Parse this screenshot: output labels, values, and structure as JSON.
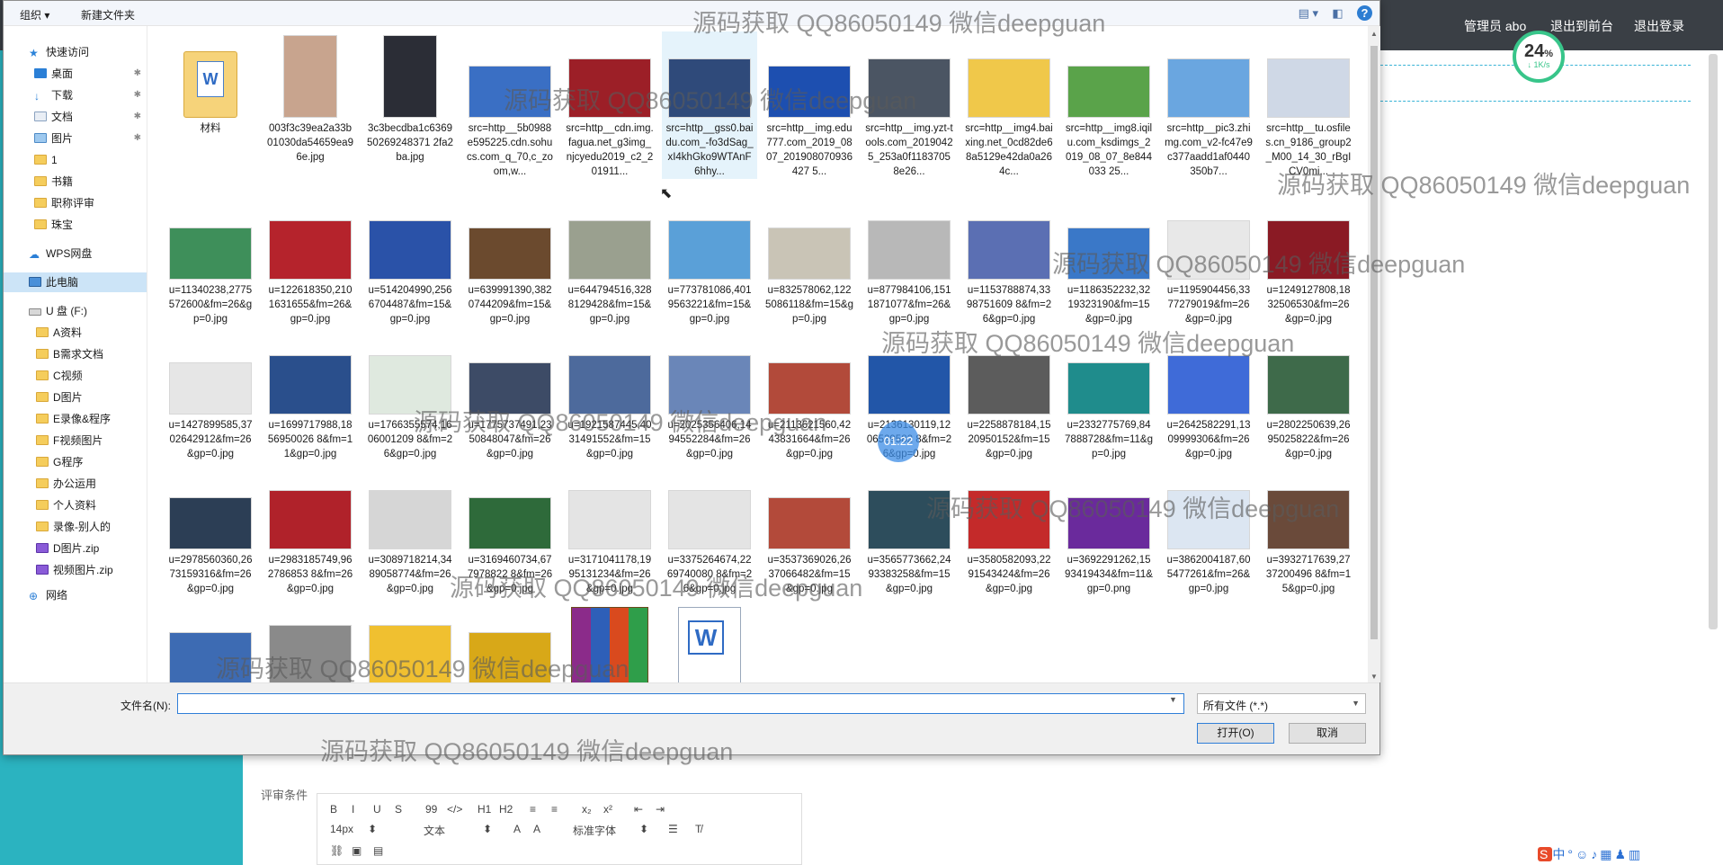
{
  "background": {
    "nav": {
      "admin": "管理员 abo",
      "front": "退出到前台",
      "logout": "退出登录"
    },
    "net_speed": {
      "percent": "24",
      "percent_unit": "%",
      "rate": "↓ 1K/s"
    },
    "criteria_label": "评审条件",
    "editor": {
      "row1": [
        "B",
        "I",
        "U",
        "S",
        "99",
        "</>",
        "H1",
        "H2",
        "≡",
        "≡",
        "x₂",
        "x²",
        "⇤",
        "⇥"
      ],
      "font_size": "14px",
      "text_kind": "文本",
      "font_family": "标准字体"
    }
  },
  "dialog": {
    "toolbar": {
      "organize": "组织 ▾",
      "new_folder": "新建文件夹"
    },
    "nav": {
      "quick_access": "快速访问",
      "items": [
        {
          "label": "桌面",
          "icon": "desktop-icon",
          "pinned": true
        },
        {
          "label": "下载",
          "icon": "download-icon",
          "pinned": true
        },
        {
          "label": "文档",
          "icon": "document-icon",
          "pinned": true
        },
        {
          "label": "图片",
          "icon": "picture-icon",
          "pinned": true
        },
        {
          "label": "1",
          "icon": "folder-icon"
        },
        {
          "label": "书籍",
          "icon": "folder-icon"
        },
        {
          "label": "职称评审",
          "icon": "folder-icon"
        },
        {
          "label": "珠宝",
          "icon": "folder-icon"
        }
      ],
      "wps": "WPS网盘",
      "this_pc": "此电脑",
      "drive": "U 盘 (F:)",
      "drive_items": [
        {
          "label": "A资料",
          "icon": "folder-icon"
        },
        {
          "label": "B需求文档",
          "icon": "folder-icon"
        },
        {
          "label": "C视频",
          "icon": "folder-icon"
        },
        {
          "label": "D图片",
          "icon": "folder-icon"
        },
        {
          "label": "E录像&程序",
          "icon": "folder-icon"
        },
        {
          "label": "F视频图片",
          "icon": "folder-icon"
        },
        {
          "label": "G程序",
          "icon": "folder-icon"
        },
        {
          "label": "办公运用",
          "icon": "folder-icon"
        },
        {
          "label": "个人资料",
          "icon": "folder-icon"
        },
        {
          "label": "录像-别人的",
          "icon": "folder-icon"
        },
        {
          "label": "D图片.zip",
          "icon": "zip-icon"
        },
        {
          "label": "视频图片.zip",
          "icon": "zip-icon"
        }
      ],
      "network": "网络"
    },
    "files": [
      {
        "name": "材料",
        "kind": "folder"
      },
      {
        "name": "003f3c39ea2a33b01030da54659ea96e.jpg",
        "color": "#c8a48e"
      },
      {
        "name": "3c3becdba1c636950269248371 2fa2ba.jpg",
        "color": "#2b2d36"
      },
      {
        "name": "src=http__5b0988e595225.cdn.sohucs.com_q_70,c_zoom,w...",
        "color": "#3a6fc4"
      },
      {
        "name": "src=http__cdn.img.fagua.net_g3img_njcyedu2019_c2_201911...",
        "color": "#9c1f27"
      },
      {
        "name": "src=http__gss0.baidu.com_-fo3dSag_xI4khGko9WTAnF6hhy...",
        "color": "#2f4a7a",
        "hover": true
      },
      {
        "name": "src=http__img.edu777.com_2019_0807_201908070936427 5...",
        "color": "#1d4fb0"
      },
      {
        "name": "src=http__img.yzt-tools.com_20190425_253a0f11837058e26...",
        "color": "#4b5563"
      },
      {
        "name": "src=http__img4.baixing.net_0cd82de68a5129e42da0a264c...",
        "color": "#f0c84a"
      },
      {
        "name": "src=http__img8.iqilu.com_ksdimgs_2019_08_07_8e844033 25...",
        "color": "#5aa34a"
      },
      {
        "name": "src=http__pic3.zhimg.com_v2-fc47e9c377aadd1af0440350b7...",
        "color": "#6aa6e0"
      },
      {
        "name": "src=http__tu.osfiles.cn_9186_group2_M00_14_30_rBgICV0mi...",
        "color": "#cfd8e6"
      },
      {
        "name": "u=11340238,2775572600&fm=26&gp=0.jpg",
        "color": "#3e8f5a"
      },
      {
        "name": "u=122618350,2101631655&fm=26&gp=0.jpg",
        "color": "#b5232c"
      },
      {
        "name": "u=514204990,2566704487&fm=15&gp=0.jpg",
        "color": "#2a52a8"
      },
      {
        "name": "u=639991390,3820744209&fm=15&gp=0.jpg",
        "color": "#6b4a2e"
      },
      {
        "name": "u=644794516,3288129428&fm=15&gp=0.jpg",
        "color": "#9aa08f"
      },
      {
        "name": "u=773781086,4019563221&fm=15&gp=0.jpg",
        "color": "#5aa0d8"
      },
      {
        "name": "u=832578062,1225086118&fm=15&gp=0.jpg",
        "color": "#c9c4b6"
      },
      {
        "name": "u=877984106,1511871077&fm=26&gp=0.jpg",
        "color": "#b8b8b8"
      },
      {
        "name": "u=1153788874,3398751609 8&fm=26&gp=0.jpg",
        "color": "#5b6fb3"
      },
      {
        "name": "u=1186352232,3219323190&fm=15&gp=0.jpg",
        "color": "#3a78c8"
      },
      {
        "name": "u=1195904456,3377279019&fm=26&gp=0.jpg",
        "color": "#e8e8e8"
      },
      {
        "name": "u=1249127808,1832506530&fm=26&gp=0.jpg",
        "color": "#8a1a24"
      },
      {
        "name": "u=1427899585,3702642912&fm=26&gp=0.jpg",
        "color": "#e6e6e6"
      },
      {
        "name": "u=1699717988,1856950026 8&fm=11&gp=0.jpg",
        "color": "#2a4f8c"
      },
      {
        "name": "u=1766355574,1606001209 8&fm=26&gp=0.jpg",
        "color": "#dfe9df"
      },
      {
        "name": "u=1775737491,2350848047&fm=26&gp=0.jpg",
        "color": "#3d4b66"
      },
      {
        "name": "u=1921587445,4031491552&fm=15&gp=0.jpg",
        "color": "#4d6a9c"
      },
      {
        "name": "u=2025356406,1494552284&fm=26&gp=0.jpg",
        "color": "#6a86b8"
      },
      {
        "name": "u=2113621560,4243831664&fm=26&gp=0.jpg",
        "color": "#b24a3a"
      },
      {
        "name": "u=2136130119,1206529582 8&fm=26&gp=0.jpg",
        "color": "#2256a8"
      },
      {
        "name": "u=2258878184,1520950152&fm=15&gp=0.jpg",
        "color": "#5c5c5c"
      },
      {
        "name": "u=2332775769,847888728&fm=11&gp=0.jpg",
        "color": "#1f8c8c"
      },
      {
        "name": "u=2642582291,1309999306&fm=26&gp=0.jpg",
        "color": "#3f6bd8"
      },
      {
        "name": "u=2802250639,2695025822&fm=26&gp=0.jpg",
        "color": "#3e6a4a"
      },
      {
        "name": "u=2978560360,2673159316&fm=26&gp=0.jpg",
        "color": "#2c3e55"
      },
      {
        "name": "u=2983185749,962786853 8&fm=26&gp=0.jpg",
        "color": "#b0222a"
      },
      {
        "name": "u=3089718214,3489058774&fm=26&gp=0.jpg",
        "color": "#d6d6d6"
      },
      {
        "name": "u=3169460734,677978822 8&fm=26&gp=0.jpg",
        "color": "#2e6a3a"
      },
      {
        "name": "u=3171041178,1995131234&fm=26&gp=0.jpg",
        "color": "#e4e4e4"
      },
      {
        "name": "u=3375264674,2269740080 8&fm=26&gp=0.jpg",
        "color": "#e4e4e4"
      },
      {
        "name": "u=3537369026,2637066482&fm=15&gp=0.jpg",
        "color": "#b34a3a"
      },
      {
        "name": "u=3565773662,2493383258&fm=15&gp=0.jpg",
        "color": "#2d4d5c"
      },
      {
        "name": "u=3580582093,2291543424&fm=26&gp=0.jpg",
        "color": "#c42a2a"
      },
      {
        "name": "u=3692291262,1593419434&fm=11&gp=0.png",
        "color": "#6a2a9c"
      },
      {
        "name": "u=3862004187,605477261&fm=26&gp=0.jpg",
        "color": "#dce6f2"
      },
      {
        "name": "u=3932717639,2737200496 8&fm=15&gp=0.jpg",
        "color": "#6a4a3a"
      },
      {
        "name": "",
        "color": "#3d6bb3"
      },
      {
        "name": "",
        "color": "#8a8a8a"
      },
      {
        "name": "",
        "color": "#f0c030"
      },
      {
        "name": "",
        "color": "#d8a818"
      },
      {
        "name": "",
        "kind": "winrar"
      },
      {
        "name": "",
        "kind": "word"
      }
    ],
    "bottom": {
      "filename_label": "文件名(N):",
      "filename_value": "",
      "filetype": "所有文件 (*.*)",
      "open": "打开(O)",
      "cancel": "取消"
    }
  },
  "overlay": {
    "watermark": "源码获取 QQ86050149 微信deepguan",
    "timer": "01:22"
  }
}
